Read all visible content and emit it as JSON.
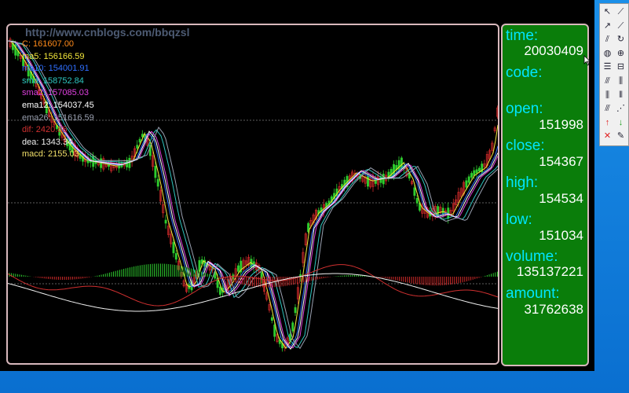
{
  "watermark": "http://www.cnblogs.com/bbqzsl",
  "legend": [
    {
      "key": "c",
      "text": "C: 161607.00",
      "color": "#ff8a1a"
    },
    {
      "key": "ma5",
      "text": "ma5: 156166.59",
      "color": "#f2e63a"
    },
    {
      "key": "ma10",
      "text": "ma10: 154001.91",
      "color": "#2f6fff"
    },
    {
      "key": "sma",
      "text": "sma: 158752.84",
      "color": "#2ec7c0"
    },
    {
      "key": "sma2",
      "text": "sma2: 157085.03",
      "color": "#e040e0"
    },
    {
      "key": "ema12",
      "text": "ema12: 154037.45",
      "color": "#ffffff"
    },
    {
      "key": "ema26",
      "text": "ema26: 151616.59",
      "color": "#9aa0b0"
    },
    {
      "key": "dif",
      "text": "dif: 2420.86",
      "color": "#d03030"
    },
    {
      "key": "dea",
      "text": "dea: 1343.34",
      "color": "#f0f0f0"
    },
    {
      "key": "macd",
      "text": "macd: 2155.03",
      "color": "#f2e06a"
    }
  ],
  "info": {
    "time_label": "time:",
    "time_value": "20030409",
    "code_label": "code:",
    "code_value": "",
    "open_label": "open:",
    "open_value": "151998",
    "close_label": "close:",
    "close_value": "154367",
    "high_label": "high:",
    "high_value": "154534",
    "low_label": "low:",
    "low_value": "151034",
    "volume_label": "volume:",
    "volume_value": "135137221",
    "amount_label": "amount:",
    "amount_value": "31762638"
  },
  "colors": {
    "up": "#d02a2a",
    "down": "#2ecc2e",
    "panel_green": "#0a7d0a",
    "label_cyan": "#00e6ff"
  },
  "toolbar_icons": [
    "cursor-arrow-icon",
    "line-tool-icon",
    "ray-tool-icon",
    "segment-tool-icon",
    "parallel-lines-icon",
    "arc-tool-icon",
    "circle-tool-icon",
    "fib-tool-icon",
    "price-level-icon",
    "channel-tool-icon",
    "fan-tool-icon",
    "gann-tool-icon",
    "speed-lines-icon",
    "cycle-lines-icon",
    "angle-fan-icon",
    "regression-tool-icon",
    "up-arrow-icon",
    "down-arrow-icon",
    "delete-icon",
    "color-picker-icon"
  ]
}
